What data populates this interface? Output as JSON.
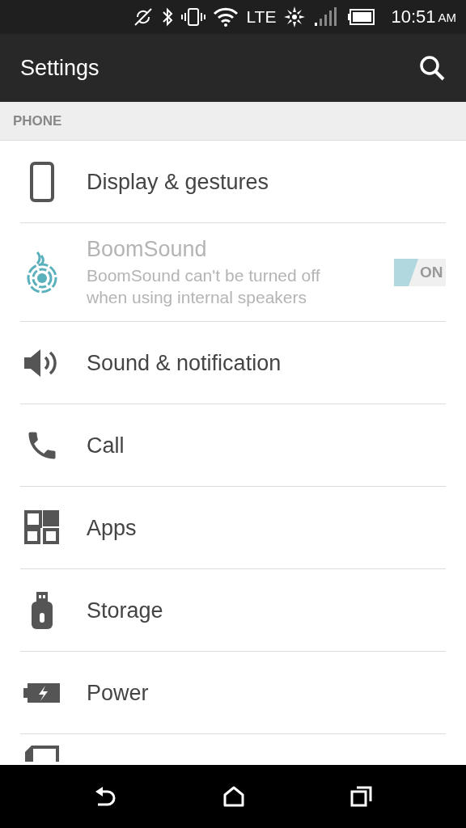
{
  "status_bar": {
    "network": "LTE",
    "time": "10:51",
    "ampm": "AM"
  },
  "app_bar": {
    "title": "Settings"
  },
  "section": {
    "title": "PHONE"
  },
  "items": [
    {
      "kind": "plain",
      "title": "Display & gestures"
    },
    {
      "kind": "toggle",
      "title": "BoomSound",
      "summary": "BoomSound can't be turned off when using internal speakers",
      "disabled": true,
      "on": true,
      "toggle_label": "ON"
    },
    {
      "kind": "plain",
      "title": "Sound & notification"
    },
    {
      "kind": "plain",
      "title": "Call"
    },
    {
      "kind": "plain",
      "title": "Apps"
    },
    {
      "kind": "plain",
      "title": "Storage"
    },
    {
      "kind": "plain",
      "title": "Power"
    }
  ]
}
